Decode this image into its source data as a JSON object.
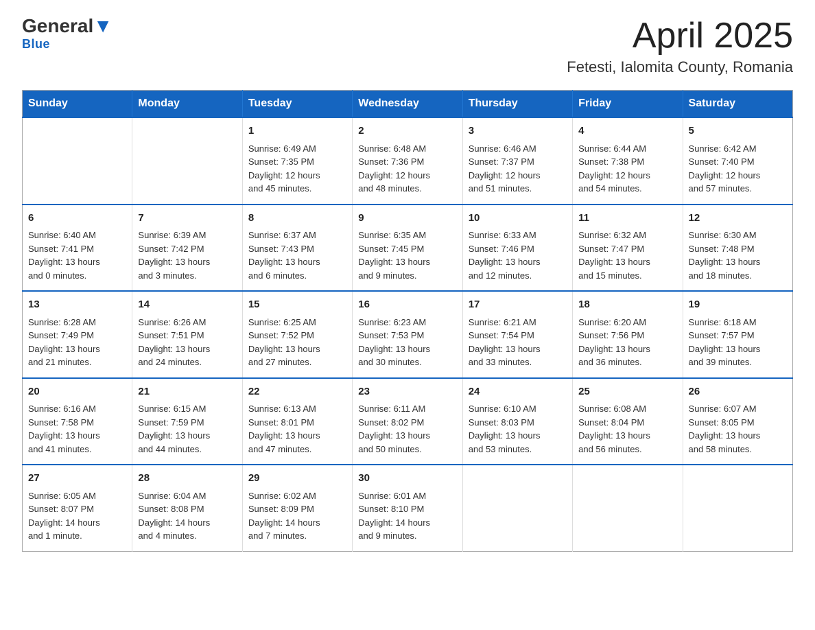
{
  "logo": {
    "general": "General",
    "blue": "Blue"
  },
  "title": "April 2025",
  "subtitle": "Fetesti, Ialomita County, Romania",
  "days_of_week": [
    "Sunday",
    "Monday",
    "Tuesday",
    "Wednesday",
    "Thursday",
    "Friday",
    "Saturday"
  ],
  "weeks": [
    [
      {
        "day": "",
        "info": ""
      },
      {
        "day": "",
        "info": ""
      },
      {
        "day": "1",
        "info": "Sunrise: 6:49 AM\nSunset: 7:35 PM\nDaylight: 12 hours\nand 45 minutes."
      },
      {
        "day": "2",
        "info": "Sunrise: 6:48 AM\nSunset: 7:36 PM\nDaylight: 12 hours\nand 48 minutes."
      },
      {
        "day": "3",
        "info": "Sunrise: 6:46 AM\nSunset: 7:37 PM\nDaylight: 12 hours\nand 51 minutes."
      },
      {
        "day": "4",
        "info": "Sunrise: 6:44 AM\nSunset: 7:38 PM\nDaylight: 12 hours\nand 54 minutes."
      },
      {
        "day": "5",
        "info": "Sunrise: 6:42 AM\nSunset: 7:40 PM\nDaylight: 12 hours\nand 57 minutes."
      }
    ],
    [
      {
        "day": "6",
        "info": "Sunrise: 6:40 AM\nSunset: 7:41 PM\nDaylight: 13 hours\nand 0 minutes."
      },
      {
        "day": "7",
        "info": "Sunrise: 6:39 AM\nSunset: 7:42 PM\nDaylight: 13 hours\nand 3 minutes."
      },
      {
        "day": "8",
        "info": "Sunrise: 6:37 AM\nSunset: 7:43 PM\nDaylight: 13 hours\nand 6 minutes."
      },
      {
        "day": "9",
        "info": "Sunrise: 6:35 AM\nSunset: 7:45 PM\nDaylight: 13 hours\nand 9 minutes."
      },
      {
        "day": "10",
        "info": "Sunrise: 6:33 AM\nSunset: 7:46 PM\nDaylight: 13 hours\nand 12 minutes."
      },
      {
        "day": "11",
        "info": "Sunrise: 6:32 AM\nSunset: 7:47 PM\nDaylight: 13 hours\nand 15 minutes."
      },
      {
        "day": "12",
        "info": "Sunrise: 6:30 AM\nSunset: 7:48 PM\nDaylight: 13 hours\nand 18 minutes."
      }
    ],
    [
      {
        "day": "13",
        "info": "Sunrise: 6:28 AM\nSunset: 7:49 PM\nDaylight: 13 hours\nand 21 minutes."
      },
      {
        "day": "14",
        "info": "Sunrise: 6:26 AM\nSunset: 7:51 PM\nDaylight: 13 hours\nand 24 minutes."
      },
      {
        "day": "15",
        "info": "Sunrise: 6:25 AM\nSunset: 7:52 PM\nDaylight: 13 hours\nand 27 minutes."
      },
      {
        "day": "16",
        "info": "Sunrise: 6:23 AM\nSunset: 7:53 PM\nDaylight: 13 hours\nand 30 minutes."
      },
      {
        "day": "17",
        "info": "Sunrise: 6:21 AM\nSunset: 7:54 PM\nDaylight: 13 hours\nand 33 minutes."
      },
      {
        "day": "18",
        "info": "Sunrise: 6:20 AM\nSunset: 7:56 PM\nDaylight: 13 hours\nand 36 minutes."
      },
      {
        "day": "19",
        "info": "Sunrise: 6:18 AM\nSunset: 7:57 PM\nDaylight: 13 hours\nand 39 minutes."
      }
    ],
    [
      {
        "day": "20",
        "info": "Sunrise: 6:16 AM\nSunset: 7:58 PM\nDaylight: 13 hours\nand 41 minutes."
      },
      {
        "day": "21",
        "info": "Sunrise: 6:15 AM\nSunset: 7:59 PM\nDaylight: 13 hours\nand 44 minutes."
      },
      {
        "day": "22",
        "info": "Sunrise: 6:13 AM\nSunset: 8:01 PM\nDaylight: 13 hours\nand 47 minutes."
      },
      {
        "day": "23",
        "info": "Sunrise: 6:11 AM\nSunset: 8:02 PM\nDaylight: 13 hours\nand 50 minutes."
      },
      {
        "day": "24",
        "info": "Sunrise: 6:10 AM\nSunset: 8:03 PM\nDaylight: 13 hours\nand 53 minutes."
      },
      {
        "day": "25",
        "info": "Sunrise: 6:08 AM\nSunset: 8:04 PM\nDaylight: 13 hours\nand 56 minutes."
      },
      {
        "day": "26",
        "info": "Sunrise: 6:07 AM\nSunset: 8:05 PM\nDaylight: 13 hours\nand 58 minutes."
      }
    ],
    [
      {
        "day": "27",
        "info": "Sunrise: 6:05 AM\nSunset: 8:07 PM\nDaylight: 14 hours\nand 1 minute."
      },
      {
        "day": "28",
        "info": "Sunrise: 6:04 AM\nSunset: 8:08 PM\nDaylight: 14 hours\nand 4 minutes."
      },
      {
        "day": "29",
        "info": "Sunrise: 6:02 AM\nSunset: 8:09 PM\nDaylight: 14 hours\nand 7 minutes."
      },
      {
        "day": "30",
        "info": "Sunrise: 6:01 AM\nSunset: 8:10 PM\nDaylight: 14 hours\nand 9 minutes."
      },
      {
        "day": "",
        "info": ""
      },
      {
        "day": "",
        "info": ""
      },
      {
        "day": "",
        "info": ""
      }
    ]
  ]
}
